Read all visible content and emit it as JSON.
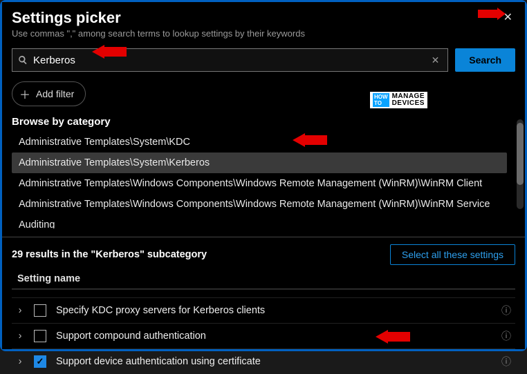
{
  "header": {
    "title": "Settings picker",
    "subtitle": "Use commas \",\" among search terms to lookup settings by their keywords"
  },
  "search": {
    "value": "Kerberos",
    "button": "Search"
  },
  "add_filter_label": "Add filter",
  "browse_label": "Browse by category",
  "categories": [
    {
      "label": "Administrative Templates\\System\\KDC",
      "selected": false
    },
    {
      "label": "Administrative Templates\\System\\Kerberos",
      "selected": true
    },
    {
      "label": "Administrative Templates\\Windows Components\\Windows Remote Management (WinRM)\\WinRM Client",
      "selected": false
    },
    {
      "label": "Administrative Templates\\Windows Components\\Windows Remote Management (WinRM)\\WinRM Service",
      "selected": false
    },
    {
      "label": "Auditing",
      "selected": false
    }
  ],
  "results": {
    "count_text": "29 results in the \"Kerberos\" subcategory",
    "select_all": "Select all these settings",
    "column_header": "Setting name",
    "items": [
      {
        "label": "Specify KDC proxy servers for Kerberos clients",
        "checked": false
      },
      {
        "label": "Support compound authentication",
        "checked": false
      },
      {
        "label": "Support device authentication using certificate",
        "checked": true
      }
    ]
  },
  "overlay_logo": {
    "line1": "MANAGE",
    "line2": "DEVICES",
    "badge": "HOW TO"
  }
}
